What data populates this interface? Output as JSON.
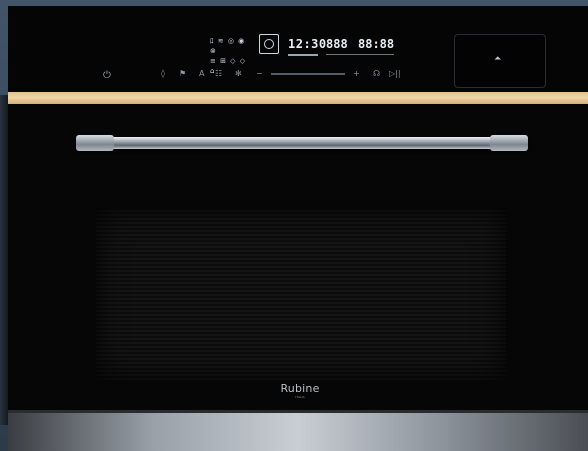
{
  "display": {
    "symbols_row1": "ﾛ ≋ ◎ ◉ ⊗",
    "symbols_row2": "≡ ⊞ ◇ ◇ ⌂",
    "time": "12:30",
    "value1": "888",
    "value2": "88:88"
  },
  "controls": {
    "power_symbol": "⏻",
    "keys": [
      "◊",
      "⚑",
      "A",
      "☷",
      "✻",
      "−",
      "+",
      "☊",
      "▷||"
    ]
  },
  "touch_window": {
    "symbol": "⏶"
  },
  "brand": {
    "name": "Rubine",
    "sub": "ITALIA"
  },
  "colors": {
    "body": "#070707",
    "trim_gold": "#e2c08c",
    "display_text": "#e8eef5",
    "steel": "#c9ced4"
  },
  "icons": [
    "power-icon",
    "program-icon",
    "warning-icon"
  ]
}
